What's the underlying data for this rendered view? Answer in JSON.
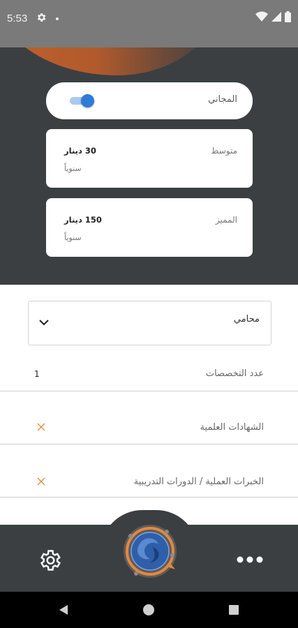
{
  "status_bar": {
    "time": "5:53"
  },
  "plans": {
    "free": {
      "label": "المجاني",
      "enabled": true
    },
    "medium": {
      "name": "متوسط",
      "price": "30 دينار",
      "period": "سنوياً"
    },
    "premium": {
      "name": "المميز",
      "price": "150 دينار",
      "period": "سنوياً"
    }
  },
  "profession_select": {
    "value": "محامي"
  },
  "rows": {
    "specialties_count": {
      "label": "عدد التخصصات",
      "value": "1"
    },
    "certificates": {
      "label": "الشهادات العلمية",
      "status_icon": "x-icon"
    },
    "experience": {
      "label": "الخبرات العملية / الدورات التدريبية",
      "status_icon": "x-icon"
    }
  },
  "bottom_nav": {
    "left_icon": "gear-icon",
    "right_icon": "more-dots-icon",
    "center_icon": "app-logo"
  },
  "colors": {
    "accent": "#e8863a",
    "toggle": "#2f7bd7",
    "dark": "#3b3f42"
  }
}
